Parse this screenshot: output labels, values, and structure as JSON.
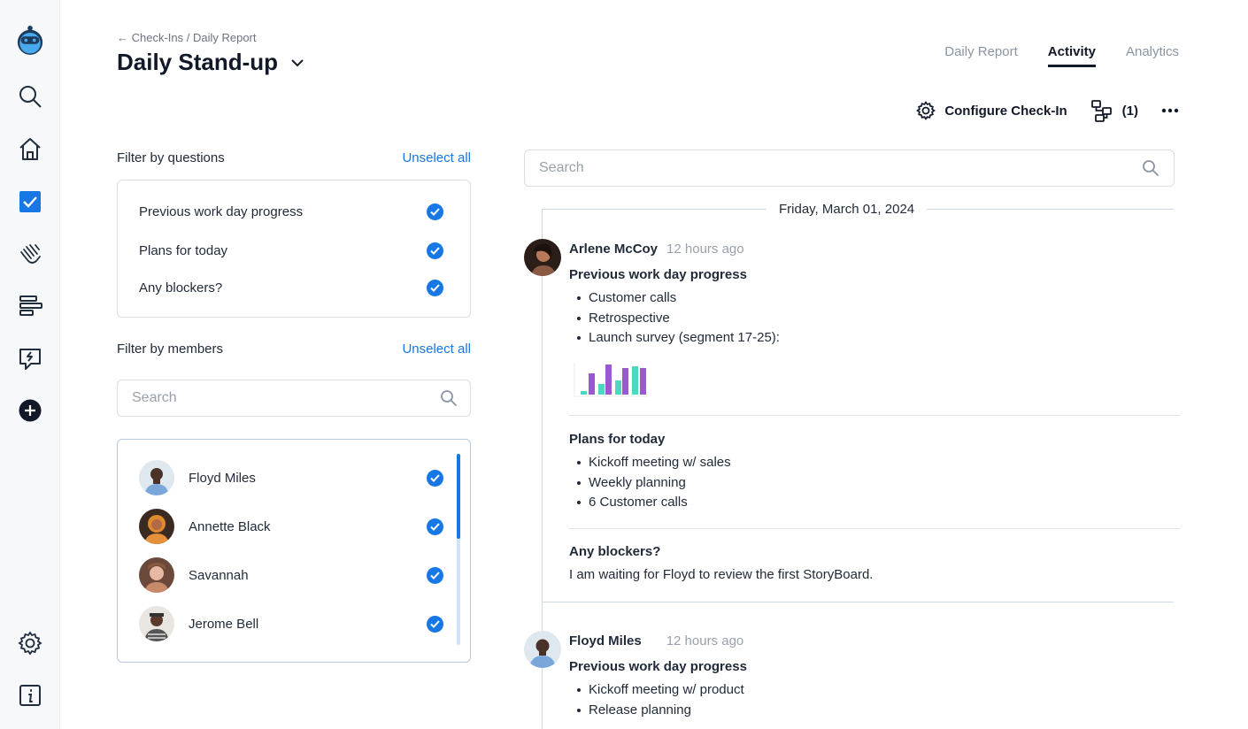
{
  "sidebar": {
    "items": [
      {
        "name": "logo",
        "icon": "robot-logo-icon"
      },
      {
        "name": "search",
        "icon": "search-icon"
      },
      {
        "name": "home",
        "icon": "home-icon"
      },
      {
        "name": "checkins",
        "icon": "checkbox-icon"
      },
      {
        "name": "kudos",
        "icon": "clapping-hands-icon"
      },
      {
        "name": "reports",
        "icon": "bars-icon"
      },
      {
        "name": "feedback",
        "icon": "chat-bolt-icon"
      },
      {
        "name": "add",
        "icon": "plus-circle-icon"
      },
      {
        "name": "settings",
        "icon": "gear-icon"
      },
      {
        "name": "info",
        "icon": "info-icon"
      }
    ]
  },
  "header": {
    "breadcrumb": "← Check-Ins / Daily Report",
    "title": "Daily Stand-up",
    "tabs": [
      {
        "label": "Daily Report",
        "active": false
      },
      {
        "label": "Activity",
        "active": true
      },
      {
        "label": "Analytics",
        "active": false
      }
    ],
    "configure_label": "Configure Check-In",
    "workflow_count": "(1)"
  },
  "filters": {
    "questions": {
      "label": "Filter by questions",
      "unselect": "Unselect all",
      "items": [
        {
          "label": "Previous work day progress",
          "checked": true
        },
        {
          "label": "Plans for today",
          "checked": true
        },
        {
          "label": "Any blockers?",
          "checked": true
        }
      ]
    },
    "members": {
      "label": "Filter by members",
      "unselect": "Unselect all",
      "search_placeholder": "Search",
      "items": [
        {
          "name": "Floyd Miles",
          "checked": true
        },
        {
          "name": "Annette Black",
          "checked": true
        },
        {
          "name": "Savannah",
          "checked": true
        },
        {
          "name": "Jerome Bell",
          "checked": true
        }
      ]
    }
  },
  "feed": {
    "search_placeholder": "Search",
    "date": "Friday, March 01, 2024",
    "entries": [
      {
        "name": "Arlene McCoy",
        "ago": "12 hours ago",
        "sections": [
          {
            "title": "Previous work day progress",
            "bullets": [
              "Customer calls",
              "Retrospective",
              "Launch survey (segment 17-25):"
            ]
          },
          {
            "title": "Plans for today",
            "bullets": [
              "Kickoff meeting w/ sales",
              "Weekly planning",
              "6 Customer calls"
            ]
          },
          {
            "title": "Any blockers?",
            "text": "I am waiting for Floyd to review the first StoryBoard."
          }
        ]
      },
      {
        "name": "Floyd Miles",
        "ago": "12 hours ago",
        "sections": [
          {
            "title": "Previous work day progress",
            "bullets": [
              "Kickoff meeting w/ product",
              "Release planning"
            ]
          }
        ]
      }
    ]
  },
  "colors": {
    "accent": "#1677e5",
    "chart_purple": "#9b59d0",
    "chart_teal": "#4fd6bf"
  }
}
